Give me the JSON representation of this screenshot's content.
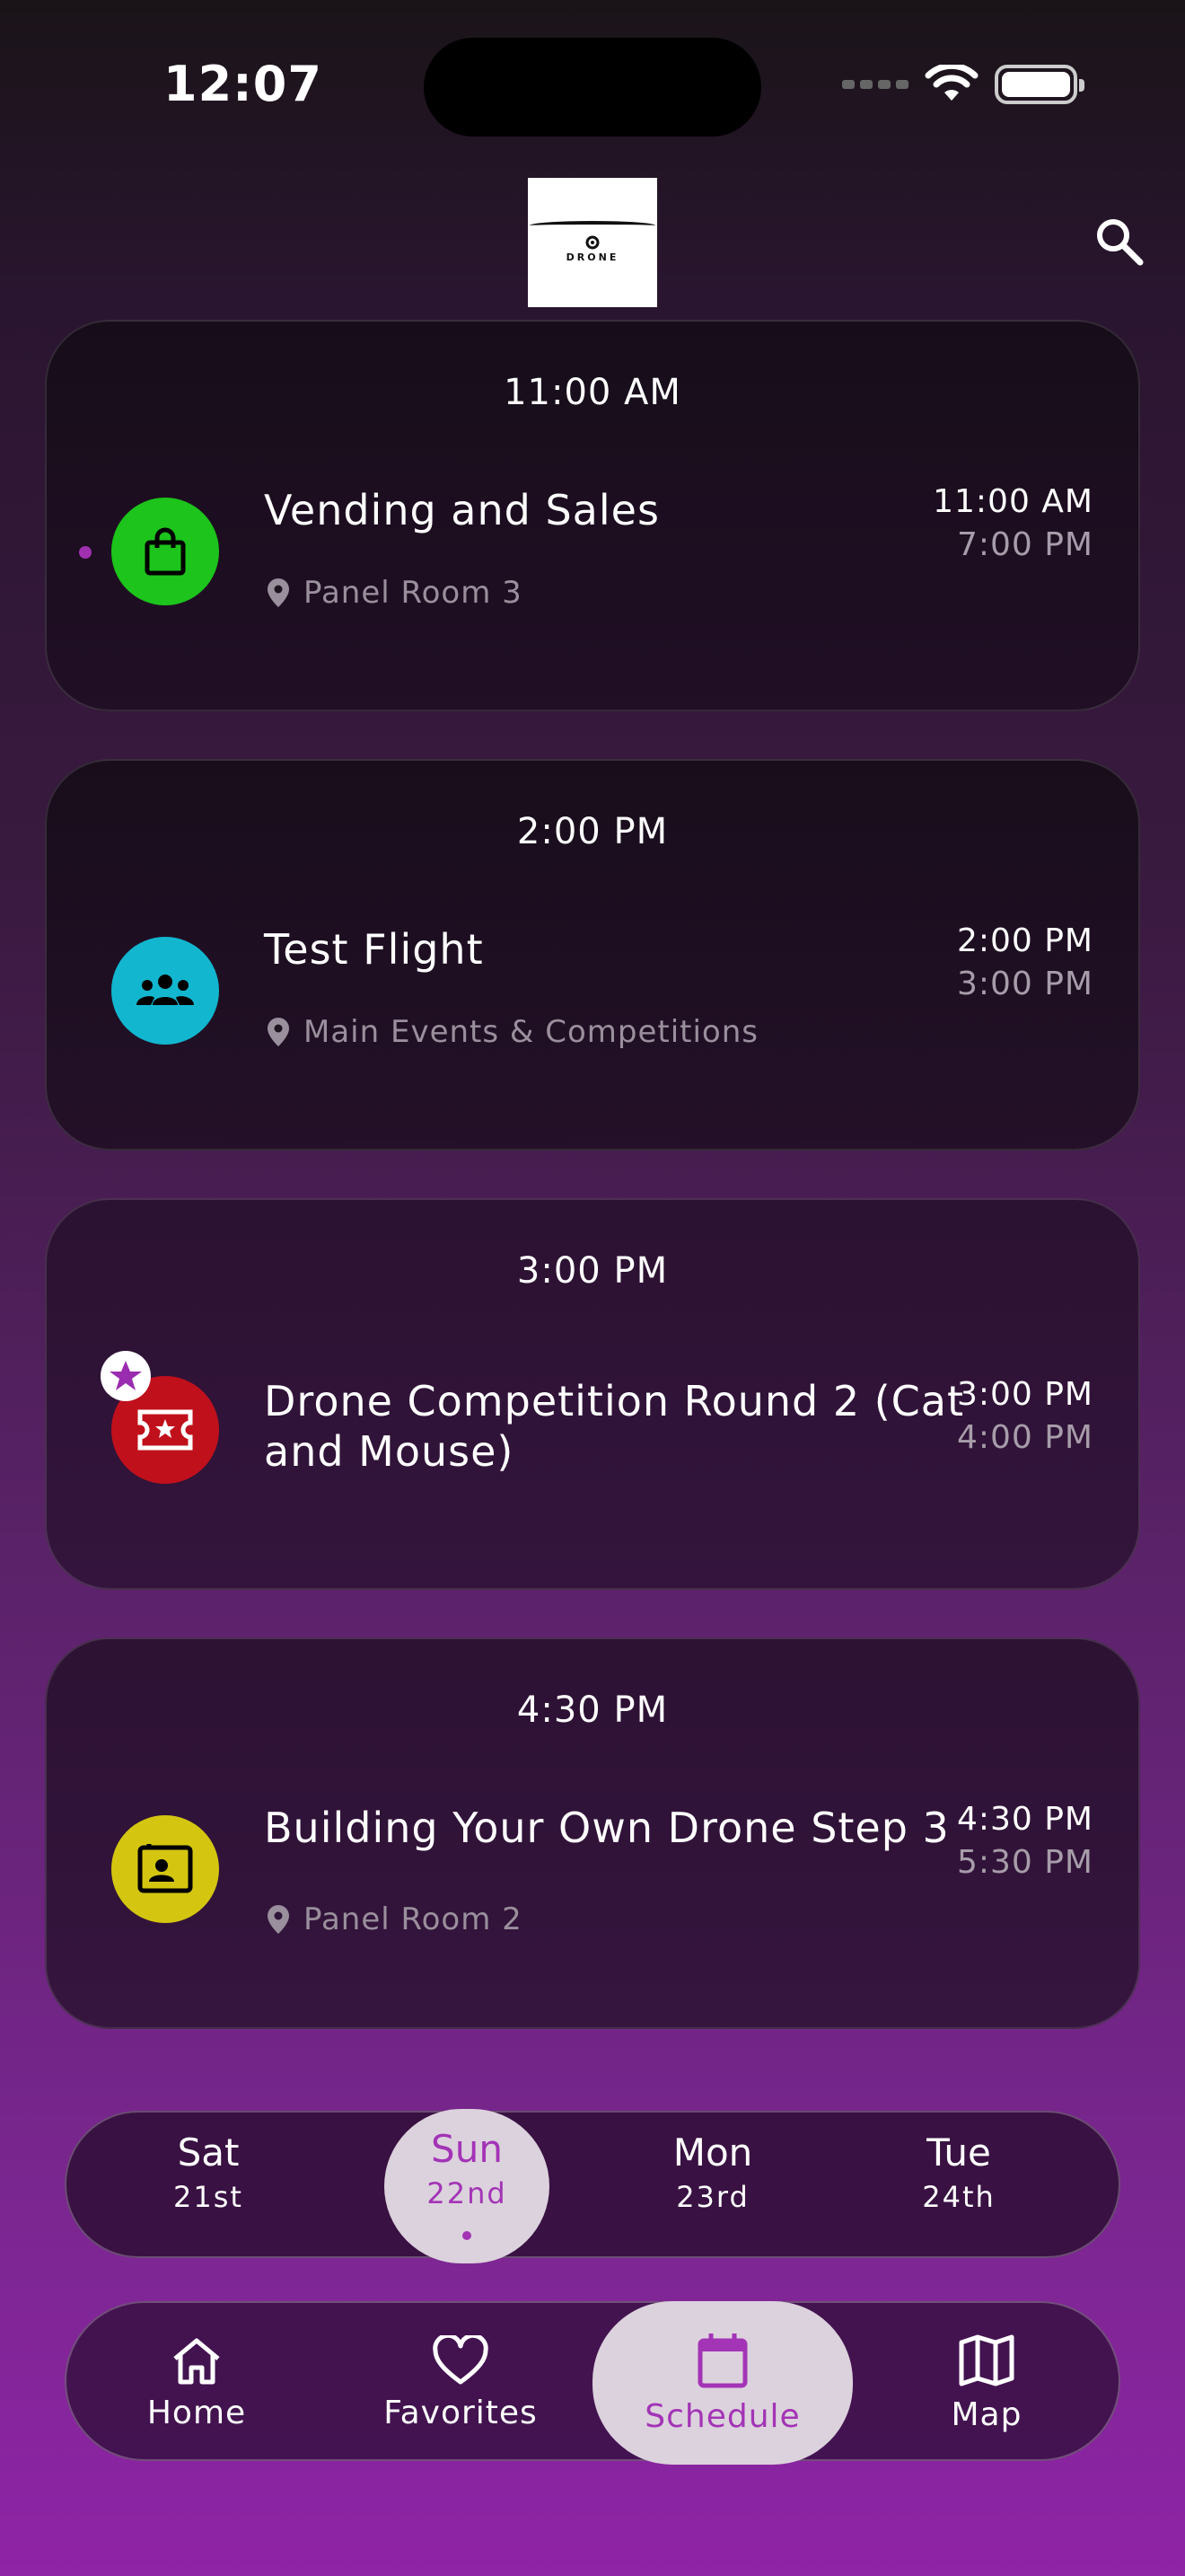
{
  "status_bar": {
    "time": "12:07"
  },
  "header": {
    "logo_text": "DRONE"
  },
  "events": [
    {
      "heading": "11:00 AM",
      "title": "Vending and Sales",
      "location": "Panel Room 3",
      "start": "11:00 AM",
      "end": "7:00 PM",
      "icon": "shopping-bag-icon",
      "icon_color": "#1cc41c",
      "live": true,
      "favorite": false
    },
    {
      "heading": "2:00 PM",
      "title": "Test Flight",
      "location": "Main Events & Competitions",
      "start": "2:00 PM",
      "end": "3:00 PM",
      "icon": "groups-icon",
      "icon_color": "#12b6cf",
      "live": false,
      "favorite": false
    },
    {
      "heading": "3:00 PM",
      "title": "Drone Competition Round 2 (Cat and Mouse)",
      "location": "",
      "start": "3:00 PM",
      "end": "4:00 PM",
      "icon": "ticket-icon",
      "icon_color": "#c0101c",
      "live": false,
      "favorite": true
    },
    {
      "heading": "4:30 PM",
      "title": "Building Your Own Drone Step 3",
      "location": "Panel Room 2",
      "start": "4:30 PM",
      "end": "5:30 PM",
      "icon": "contact-card-icon",
      "icon_color": "#d4c610",
      "live": false,
      "favorite": false
    }
  ],
  "days": [
    {
      "name": "Sat",
      "date": "21st",
      "active": false
    },
    {
      "name": "Sun",
      "date": "22nd",
      "active": true
    },
    {
      "name": "Mon",
      "date": "23rd",
      "active": false
    },
    {
      "name": "Tue",
      "date": "24th",
      "active": false
    }
  ],
  "tabs": [
    {
      "label": "Home",
      "icon": "home-icon",
      "active": false
    },
    {
      "label": "Favorites",
      "icon": "heart-icon",
      "active": false
    },
    {
      "label": "Schedule",
      "icon": "calendar-icon",
      "active": true
    },
    {
      "label": "Map",
      "icon": "map-icon",
      "active": false
    }
  ],
  "colors": {
    "accent": "#a334b6",
    "selected_bg": "#dcd2dd"
  }
}
